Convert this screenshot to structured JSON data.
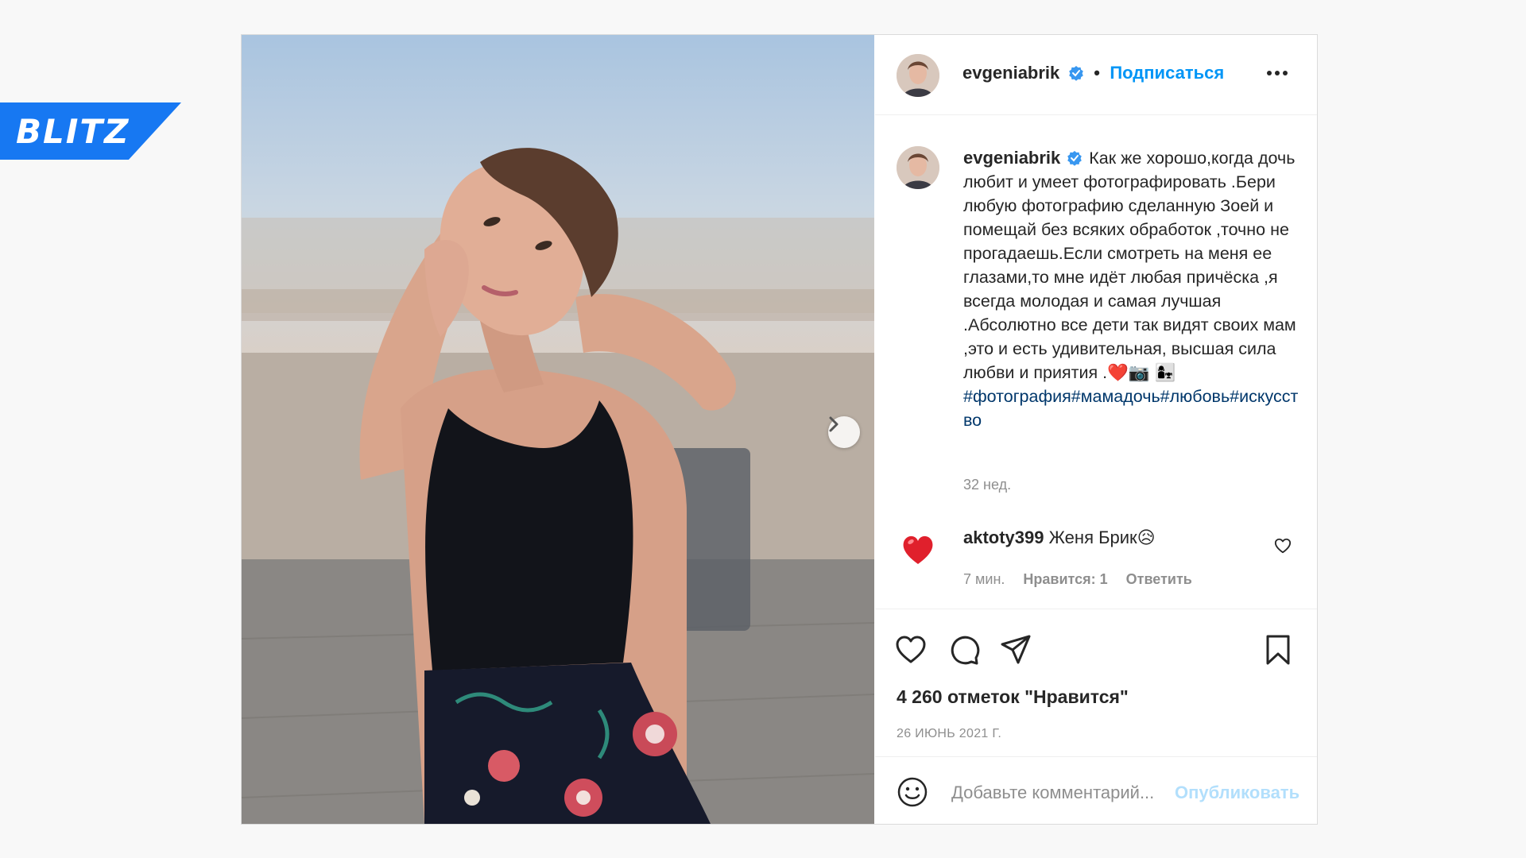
{
  "logo": {
    "text": "BLITZ",
    "color": "#1778f2"
  },
  "post": {
    "username": "evgeniabrik",
    "verified": true,
    "follow_label": "Подписаться",
    "more_icon": "more-dots-icon",
    "caption": "Как же хорошо,когда дочь любит и умеет фотографировать .Бери любую фотографию сделанную Зоей и помещай без всяких обработок ,точно не прогадаешь.Если смотреть на меня ее глазами,то мне идёт любая причёска ,я всегда молодая и самая лучшая .Абсолютно все дети так видят своих мам ,это и есть удивительная, высшая сила любви и приятия .❤️📷 👩‍👧",
    "hashtags": "#фотография#мамадочь#любовь#искусство",
    "time_ago": "32 нед.",
    "likes": "4 260 отметок \"Нравится\"",
    "date": "26 ИЮНЬ 2021 Г."
  },
  "comment": {
    "username": "aktoty399",
    "text": "Женя Брик😥",
    "time": "7 мин.",
    "likes": "Нравится: 1",
    "reply": "Ответить"
  },
  "composer": {
    "placeholder": "Добавьте комментарий...",
    "publish_label": "Опубликовать"
  },
  "colors": {
    "link_blue": "#0095f6",
    "hashtag": "#00376b",
    "muted": "#8e8e8e",
    "publish_disabled": "#b2dffc"
  }
}
